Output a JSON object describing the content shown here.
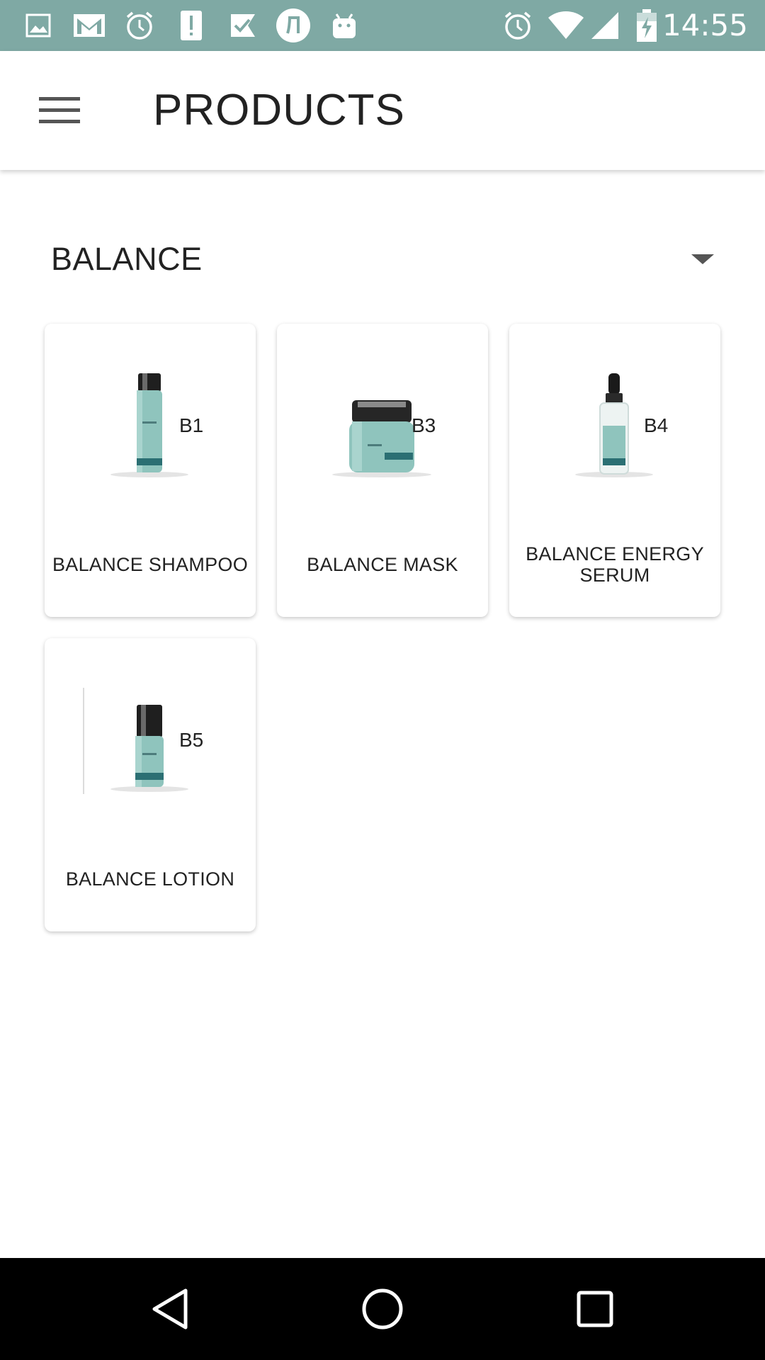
{
  "status_bar": {
    "time": "14:55",
    "bg_color": "#7fa9a4",
    "left_icons": [
      "image-icon",
      "mail-icon",
      "alarm-icon",
      "alert-icon",
      "check-flag-icon",
      "badge-icon",
      "android-icon"
    ],
    "right_icons": [
      "alarm-icon",
      "wifi-icon",
      "signal-icon",
      "battery-charging-icon"
    ]
  },
  "app_bar": {
    "menu_icon": "hamburger-menu-icon",
    "title": "PRODUCTS"
  },
  "category": {
    "selected": "BALANCE",
    "dropdown_icon": "dropdown-arrow-icon"
  },
  "products": [
    {
      "code": "B1",
      "name": "BALANCE SHAMPOO",
      "image": "shampoo-bottle"
    },
    {
      "code": "B3",
      "name": "BALANCE MASK",
      "image": "mask-jar"
    },
    {
      "code": "B4",
      "name": "BALANCE ENERGY SERUM",
      "image": "serum-dropper-bottle"
    },
    {
      "code": "B5",
      "name": "BALANCE LOTION",
      "image": "lotion-bottle"
    }
  ],
  "nav_bar": {
    "back_icon": "back-icon",
    "home_icon": "home-icon",
    "recents_icon": "recents-icon"
  }
}
